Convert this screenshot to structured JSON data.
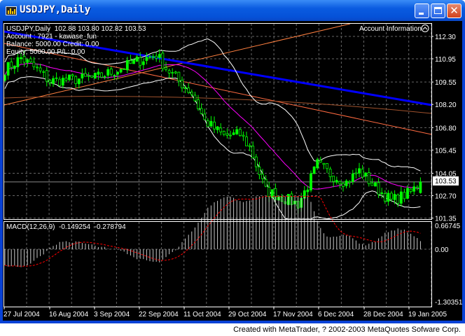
{
  "window": {
    "title": "USDJPY,Daily",
    "buttons": [
      "minimize",
      "maximize",
      "close"
    ]
  },
  "info": {
    "line1": "USDJPY,Daily  102.88 103.80 102.82 103.53",
    "line2": "Account : 7921 - kawase_fun",
    "line3": "Balance: 5000.00 Credit: 0.00",
    "line4": "Equity: 5000.00 P/L: 0.00",
    "account_panel": "Account Information"
  },
  "price_axis": [
    "112.30",
    "110.95",
    "109.55",
    "108.20",
    "106.80",
    "105.45",
    "104.05",
    "102.70",
    "101.35"
  ],
  "current_price": "103.53",
  "macd": {
    "label": "MACD(12,26,9)  -0.149254  -0.278794",
    "axis": [
      "0.66745",
      "0.00",
      "-1.30351"
    ]
  },
  "date_axis": [
    "27 Jul 2004",
    "16 Aug 2004",
    "3 Sep 2004",
    "22 Sep 2004",
    "11 Oct 2004",
    "29 Oct 2004",
    "17 Nov 2004",
    "6 Dec 2004",
    "28 Dec 2004",
    "19 Jan 2005"
  ],
  "footer": "Created with MetaTrader, ? 2002-2003 MetaQuotes Sofware Corp.",
  "colors": {
    "background": "#000000",
    "bull": "#00ff00",
    "ma": "#ff00ff",
    "bands": "#ffffff",
    "trend_blue": "#0000ff",
    "trend_orange": "#ff8040",
    "macd_signal": "#ff0000",
    "window": "#0842d6"
  },
  "chart_data": {
    "type": "candlestick",
    "symbol": "USDJPY",
    "timeframe": "Daily",
    "ylim": [
      101.35,
      112.3
    ],
    "macd_ylim": [
      -1.30351,
      0.66745
    ],
    "close_path": [
      [
        "2004-07-27",
        110.3
      ],
      [
        "2004-08-03",
        111.0
      ],
      [
        "2004-08-10",
        110.3
      ],
      [
        "2004-08-16",
        109.6
      ],
      [
        "2004-08-25",
        109.7
      ],
      [
        "2004-09-03",
        109.8
      ],
      [
        "2004-09-13",
        110.2
      ],
      [
        "2004-09-22",
        110.8
      ],
      [
        "2004-09-30",
        111.2
      ],
      [
        "2004-10-05",
        110.4
      ],
      [
        "2004-10-11",
        109.6
      ],
      [
        "2004-10-15",
        108.9
      ],
      [
        "2004-10-21",
        107.2
      ],
      [
        "2004-10-29",
        106.3
      ],
      [
        "2004-11-05",
        106.4
      ],
      [
        "2004-11-10",
        105.6
      ],
      [
        "2004-11-17",
        103.0
      ],
      [
        "2004-11-24",
        102.6
      ],
      [
        "2004-12-01",
        102.2
      ],
      [
        "2004-12-06",
        103.3
      ],
      [
        "2004-12-09",
        104.6
      ],
      [
        "2004-12-15",
        104.0
      ],
      [
        "2004-12-22",
        103.5
      ],
      [
        "2004-12-28",
        104.2
      ],
      [
        "2005-01-04",
        103.2
      ],
      [
        "2005-01-11",
        102.4
      ],
      [
        "2005-01-19",
        102.9
      ],
      [
        "2005-01-24",
        103.53
      ]
    ],
    "last_bar": {
      "open": 102.88,
      "high": 103.8,
      "low": 102.82,
      "close": 103.53
    }
  }
}
